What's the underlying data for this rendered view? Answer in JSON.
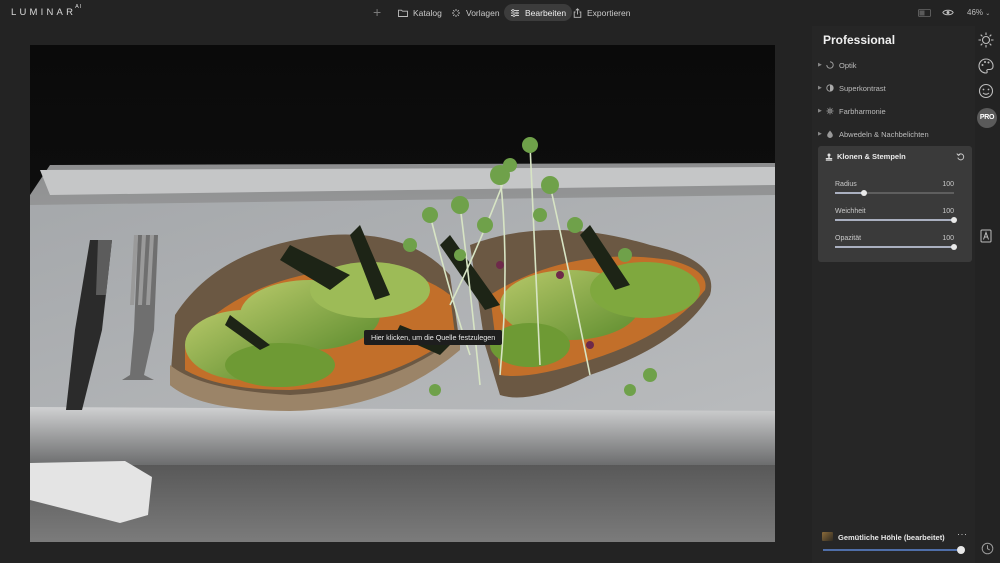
{
  "app": {
    "logo": "LUMINAR",
    "logo_version": "AI",
    "zoom": "46%"
  },
  "topnav": {
    "add_label": "+",
    "tabs": [
      {
        "label": "Katalog",
        "icon": "folder-icon",
        "active": false
      },
      {
        "label": "Vorlagen",
        "icon": "sparkle-icon",
        "active": false
      },
      {
        "label": "Bearbeiten",
        "icon": "sliders-icon",
        "active": true
      },
      {
        "label": "Exportieren",
        "icon": "share-icon",
        "active": false
      }
    ]
  },
  "canvas": {
    "tooltip": "Hier klicken, um die Quelle festzulegen"
  },
  "panel": {
    "title": "Professional",
    "sections": [
      {
        "label": "Optik",
        "icon": "circle-arc-icon"
      },
      {
        "label": "Superkontrast",
        "icon": "half-circle-icon"
      },
      {
        "label": "Farbharmonie",
        "icon": "color-wheel-icon"
      },
      {
        "label": "Abwedeln & Nachbelichten",
        "icon": "drop-icon"
      }
    ],
    "active_tool": {
      "label": "Klonen & Stempeln",
      "icon": "stamp-icon",
      "sliders": [
        {
          "label": "Radius",
          "value": "100",
          "level": 0.24
        },
        {
          "label": "Weichheit",
          "value": "100",
          "level": 1.0
        },
        {
          "label": "Opazität",
          "value": "100",
          "level": 1.0
        }
      ]
    }
  },
  "side_tools": [
    "sun-icon",
    "palette-icon",
    "face-icon",
    "pro-badge",
    "portrait-a-icon"
  ],
  "pro_badge": "PRO",
  "look": {
    "name": "Gemütliche Höhle (bearbeitet)",
    "more": "···",
    "amount": 1.0
  },
  "colors": {
    "accent": "#4f6ea8",
    "panel": "#262626",
    "card": "#3a3a3a"
  }
}
